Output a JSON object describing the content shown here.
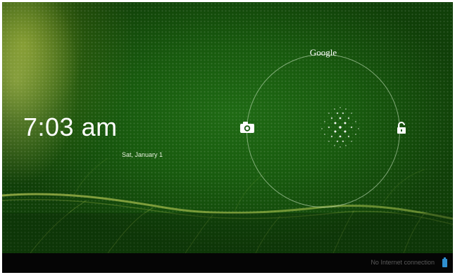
{
  "lockscreen": {
    "time": "7:03 am",
    "date": "Sat, January 1",
    "search_label": "Google"
  },
  "status_bar": {
    "message": "No Internet connection"
  },
  "icons": {
    "camera": "camera-icon",
    "unlock": "unlock-icon",
    "battery": "battery-icon",
    "handle": "unlock-handle-icon"
  },
  "colors": {
    "wallpaper_green": "#185a0e",
    "ring": "#d2ebc8",
    "battery": "#2f8fd0",
    "status_bar_bg": "#050505"
  }
}
